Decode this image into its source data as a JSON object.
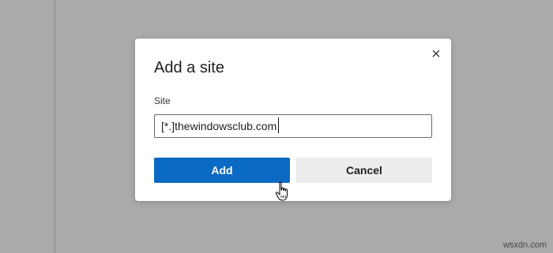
{
  "dialog": {
    "title": "Add a site",
    "field_label": "Site",
    "input_value": "[*.]thewindowsclub.com",
    "add_label": "Add",
    "cancel_label": "Cancel"
  },
  "watermark": "wsxdn.com",
  "colors": {
    "accent": "#0a6ac4",
    "backdrop": "#aaaaaa",
    "cancel_bg": "#ececec"
  },
  "icons": {
    "close": "close-icon",
    "pointer": "hand-pointer-icon"
  }
}
